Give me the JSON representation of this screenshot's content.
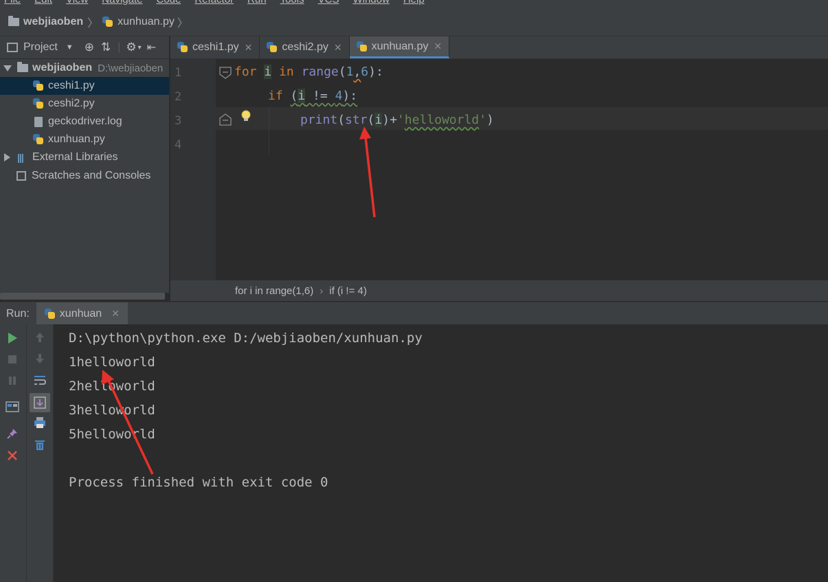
{
  "menu": [
    "File",
    "Edit",
    "View",
    "Navigate",
    "Code",
    "Refactor",
    "Run",
    "Tools",
    "VCS",
    "Window",
    "Help"
  ],
  "nav": {
    "project": "webjiaoben",
    "file": "xunhuan.py",
    "sep": "〉"
  },
  "project_panel": {
    "title": "Project",
    "root": "webjiaoben",
    "root_path": "D:\\webjiaoben",
    "files": [
      "ceshi1.py",
      "ceshi2.py",
      "geckodriver.log",
      "xunhuan.py"
    ],
    "external": "External Libraries",
    "scratches": "Scratches and Consoles"
  },
  "tabs": [
    {
      "label": "ceshi1.py",
      "active": false
    },
    {
      "label": "ceshi2.py",
      "active": false
    },
    {
      "label": "xunhuan.py",
      "active": true
    }
  ],
  "editor": {
    "line_numbers": [
      "1",
      "2",
      "3",
      "4"
    ],
    "line1": {
      "kw": "for",
      "sp1": " ",
      "var": "i",
      "sp2": " ",
      "kw2": "in",
      "sp3": " ",
      "fn": "range",
      "p1": "(",
      "n1": "1",
      "comma": ",",
      "n2": "6",
      "p2": "):"
    },
    "line2": {
      "kw": "if",
      "sp": " ",
      "p1": "(",
      "var": "i",
      "op": " != ",
      "n": "4",
      "p2": "):"
    },
    "line3": {
      "fn": "print",
      "p1": "(",
      "fn2": "str",
      "p2": "(",
      "var": "i",
      "p3": ")+",
      "q1": "'",
      "s": "helloworld",
      "q2": "'",
      "p4": ")"
    }
  },
  "breadcrumb": {
    "item1": "for i in range(1,6)",
    "sep": "›",
    "item2": "if (i != 4)"
  },
  "run": {
    "label": "Run:",
    "tab": "xunhuan",
    "output": [
      "D:\\python\\python.exe D:/webjiaoben/xunhuan.py",
      "1helloworld",
      "2helloworld",
      "3helloworld",
      "5helloworld",
      "",
      "Process finished with exit code 0"
    ]
  },
  "colors": {
    "accent": "#4a88c7",
    "annotation": "#e8302a",
    "keyword": "#cc7832",
    "builtin": "#8888c6",
    "number": "#6897bb",
    "string": "#6a8759"
  }
}
